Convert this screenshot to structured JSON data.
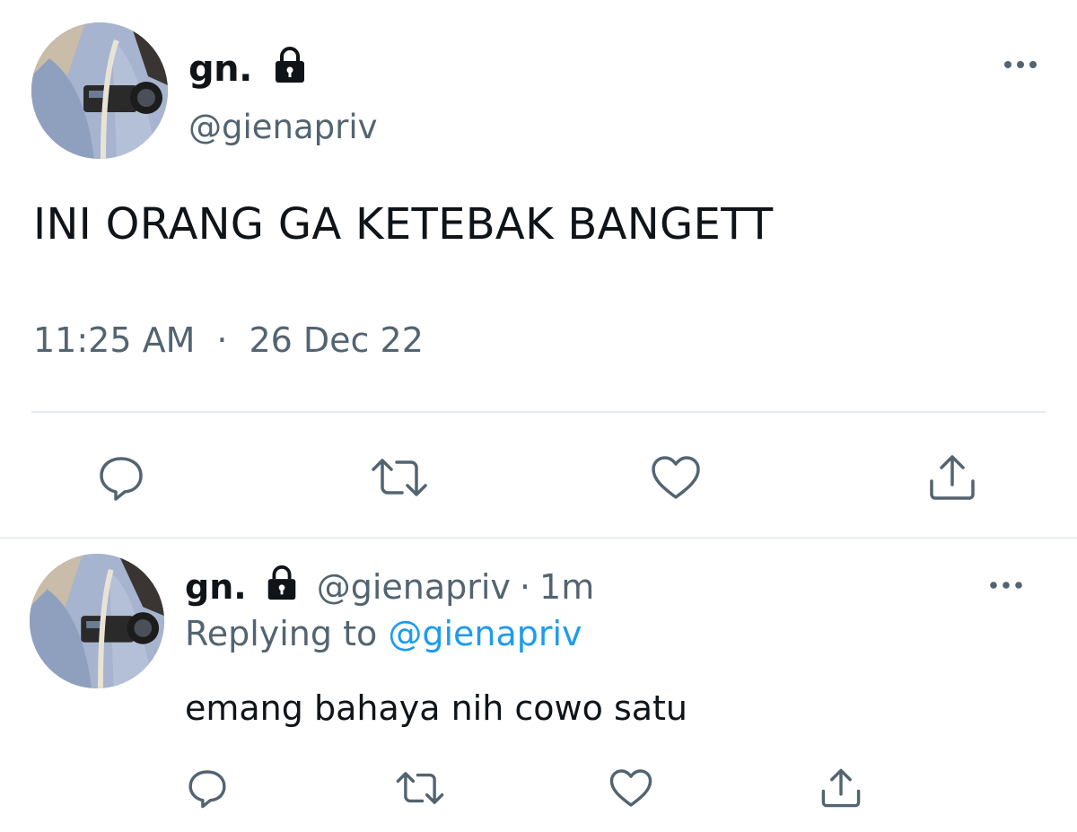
{
  "main_tweet": {
    "display_name": "gn.",
    "handle": "@gienapriv",
    "text": "INI ORANG GA KETEBAK BANGETT",
    "time": "11:25 AM",
    "dot": "·",
    "date": "26 Dec 22"
  },
  "reply_tweet": {
    "display_name": "gn.",
    "handle": "@gienapriv",
    "separator": "·",
    "age": "1m",
    "replying_prefix": "Replying to",
    "replying_to": "@gienapriv",
    "text": "emang bahaya nih cowo satu"
  },
  "icons": {
    "lock": "lock-icon",
    "more": "more-icon",
    "reply": "reply-icon",
    "retweet": "retweet-icon",
    "like": "like-icon",
    "share": "share-icon"
  },
  "colors": {
    "text": "#0f1419",
    "secondary": "#536471",
    "link": "#1d9bf0",
    "divider": "#e6ecf0"
  }
}
